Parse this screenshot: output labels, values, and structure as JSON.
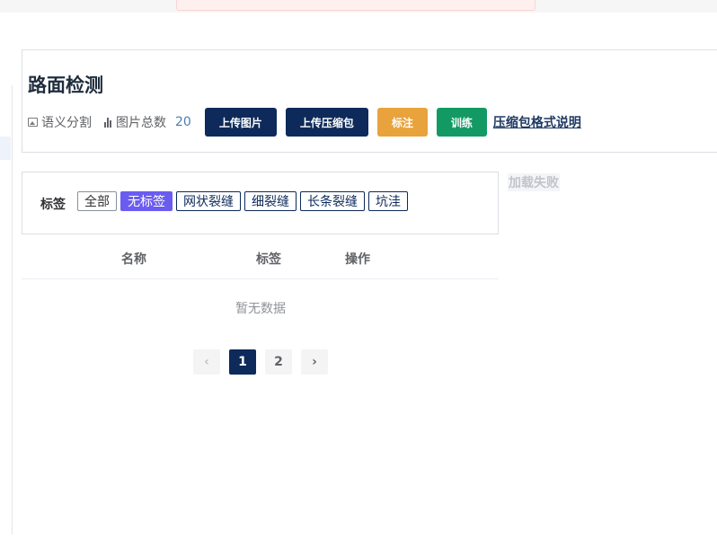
{
  "header": {
    "title": "路面检测",
    "task_type": "语义分割",
    "total_label": "图片总数",
    "total_count": "20",
    "buttons": {
      "upload_image": "上传图片",
      "upload_zip": "上传压缩包",
      "annotate": "标注",
      "train": "训练"
    },
    "zip_help_link": "压缩包格式说明"
  },
  "filter": {
    "label": "标签",
    "tags": [
      "全部",
      "无标签",
      "网状裂缝",
      "细裂缝",
      "长条裂缝",
      "坑洼"
    ],
    "active_tag": "无标签"
  },
  "side_preview": {
    "status": "加载失败"
  },
  "table": {
    "columns": [
      "名称",
      "标签",
      "操作"
    ],
    "empty_text": "暂无数据"
  },
  "pagination": {
    "prev": "‹",
    "pages": [
      "1",
      "2"
    ],
    "current": "1",
    "next": "›"
  },
  "colors": {
    "navy": "#0d2a5a",
    "orange": "#e8a33c",
    "green": "#139a64",
    "active_tag": "#6b5cf0"
  },
  "icons": [
    "image-icon",
    "bar-chart-icon",
    "chevron-left-icon",
    "chevron-right-icon"
  ]
}
